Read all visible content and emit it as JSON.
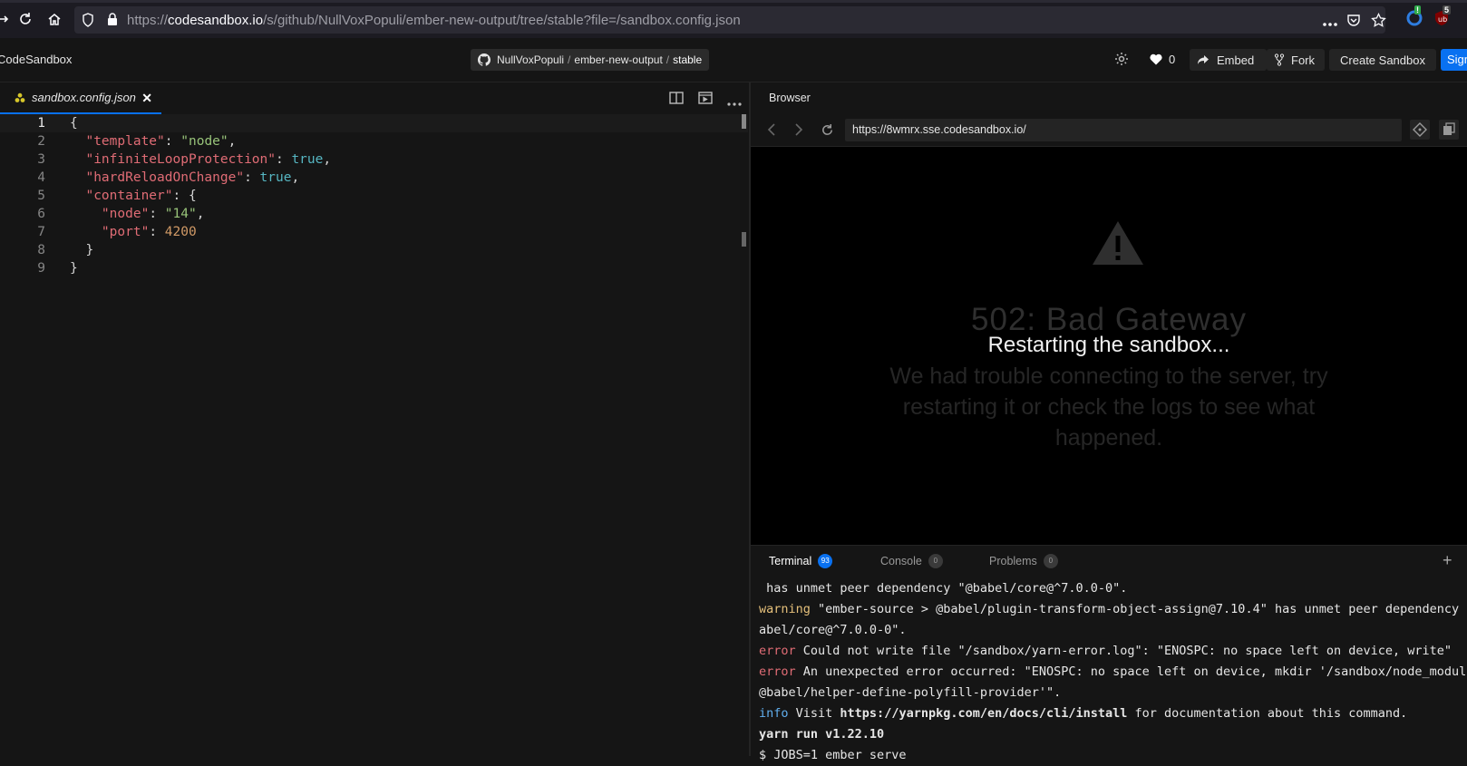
{
  "browser": {
    "url_domain": "codesandbox.io",
    "url_prefix": "https://",
    "url_path": "/s/github/NullVoxPopuli/ember-new-output/tree/stable?file=/sandbox.config.json",
    "ext_badge_1": "!",
    "ext_badge_2": "5"
  },
  "header": {
    "app_name": "CodeSandbox",
    "repo_owner": "NullVoxPopuli",
    "repo_name": "ember-new-output",
    "branch": "stable",
    "likes": "0",
    "embed_label": "Embed",
    "fork_label": "Fork",
    "create_label": "Create Sandbox",
    "signin_label": "Sign"
  },
  "editor": {
    "tab_name": "sandbox.config.json",
    "lines": [
      {
        "n": "1",
        "parts": [
          {
            "t": "{",
            "c": "p"
          }
        ]
      },
      {
        "n": "2",
        "parts": [
          {
            "t": "  ",
            "c": "p"
          },
          {
            "t": "\"template\"",
            "c": "k"
          },
          {
            "t": ": ",
            "c": "p"
          },
          {
            "t": "\"node\"",
            "c": "s"
          },
          {
            "t": ",",
            "c": "p"
          }
        ]
      },
      {
        "n": "3",
        "parts": [
          {
            "t": "  ",
            "c": "p"
          },
          {
            "t": "\"infiniteLoopProtection\"",
            "c": "k"
          },
          {
            "t": ": ",
            "c": "p"
          },
          {
            "t": "true",
            "c": "b"
          },
          {
            "t": ",",
            "c": "p"
          }
        ]
      },
      {
        "n": "4",
        "parts": [
          {
            "t": "  ",
            "c": "p"
          },
          {
            "t": "\"hardReloadOnChange\"",
            "c": "k"
          },
          {
            "t": ": ",
            "c": "p"
          },
          {
            "t": "true",
            "c": "b"
          },
          {
            "t": ",",
            "c": "p"
          }
        ]
      },
      {
        "n": "5",
        "parts": [
          {
            "t": "  ",
            "c": "p"
          },
          {
            "t": "\"container\"",
            "c": "k"
          },
          {
            "t": ": {",
            "c": "p"
          }
        ]
      },
      {
        "n": "6",
        "parts": [
          {
            "t": "    ",
            "c": "p"
          },
          {
            "t": "\"node\"",
            "c": "k"
          },
          {
            "t": ": ",
            "c": "p"
          },
          {
            "t": "\"14\"",
            "c": "s"
          },
          {
            "t": ",",
            "c": "p"
          }
        ]
      },
      {
        "n": "7",
        "parts": [
          {
            "t": "    ",
            "c": "p"
          },
          {
            "t": "\"port\"",
            "c": "k"
          },
          {
            "t": ": ",
            "c": "p"
          },
          {
            "t": "4200",
            "c": "n"
          }
        ]
      },
      {
        "n": "8",
        "parts": [
          {
            "t": "  }",
            "c": "p"
          }
        ]
      },
      {
        "n": "9",
        "parts": [
          {
            "t": "}",
            "c": "p"
          }
        ]
      }
    ]
  },
  "preview": {
    "title": "Browser",
    "address": "https://8wmrx.sse.codesandbox.io/",
    "error_title": "502: Bad Gateway",
    "error_message": "We had trouble connecting to the server, try restarting it or check the logs to see what happened.",
    "overlay": "Restarting the sandbox..."
  },
  "terminal": {
    "tabs": [
      {
        "label": "Terminal",
        "count": "93"
      },
      {
        "label": "Console",
        "count": "0"
      },
      {
        "label": "Problems",
        "count": "0"
      }
    ],
    "lines": [
      {
        "level": "",
        "text": " has unmet peer dependency \"@babel/core@^7.0.0-0\"."
      },
      {
        "level": "warning",
        "text": " \"ember-source > @babel/plugin-transform-object-assign@7.10.4\" has unmet peer dependency \"@"
      },
      {
        "level": "",
        "text": "abel/core@^7.0.0-0\"."
      },
      {
        "level": "error",
        "text": " Could not write file \"/sandbox/yarn-error.log\": \"ENOSPC: no space left on device, write\""
      },
      {
        "level": "error",
        "text": " An unexpected error occurred: \"ENOSPC: no space left on device, mkdir '/sandbox/node_modules/"
      },
      {
        "level": "",
        "text": "@babel/helper-define-polyfill-provider'\"."
      },
      {
        "level": "info",
        "text": " Visit ",
        "bold": "https://yarnpkg.com/en/docs/cli/install",
        "rest": " for documentation about this command."
      },
      {
        "level": "",
        "text": "yarn run v1.22.10",
        "strong": true
      },
      {
        "level": "",
        "text": "$ JOBS=1 ember serve"
      }
    ]
  }
}
